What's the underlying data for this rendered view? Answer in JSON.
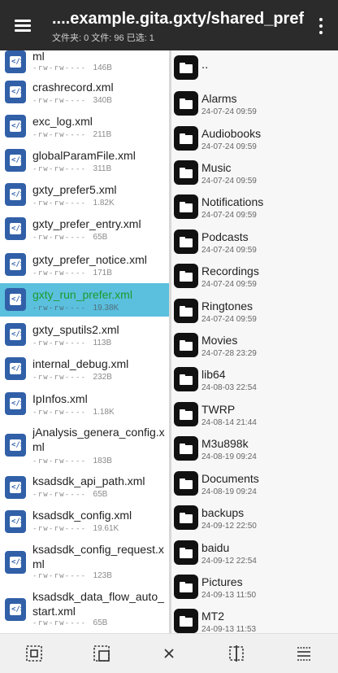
{
  "header": {
    "title": "....example.gita.gxty/shared_prefs/",
    "subtitle": "文件夹: 0  文件: 96  已选: 1"
  },
  "left_pane": {
    "files": [
      {
        "name": "ml",
        "perm": "-rw-rw----",
        "size": "146B",
        "selected": false
      },
      {
        "name": "crashrecord.xml",
        "perm": "-rw-rw----",
        "size": "340B",
        "selected": false
      },
      {
        "name": "exc_log.xml",
        "perm": "-rw-rw----",
        "size": "211B",
        "selected": false
      },
      {
        "name": "globalParamFile.xml",
        "perm": "-rw-rw----",
        "size": "311B",
        "selected": false
      },
      {
        "name": "gxty_prefer5.xml",
        "perm": "-rw-rw----",
        "size": "1.82K",
        "selected": false
      },
      {
        "name": "gxty_prefer_entry.xml",
        "perm": "-rw-rw----",
        "size": "65B",
        "selected": false
      },
      {
        "name": "gxty_prefer_notice.xml",
        "perm": "-rw-rw----",
        "size": "171B",
        "selected": false
      },
      {
        "name": "gxty_run_prefer.xml",
        "perm": "-rw-rw----",
        "size": "19.38K",
        "selected": true
      },
      {
        "name": "gxty_sputils2.xml",
        "perm": "-rw-rw----",
        "size": "113B",
        "selected": false
      },
      {
        "name": "internal_debug.xml",
        "perm": "-rw-rw----",
        "size": "232B",
        "selected": false
      },
      {
        "name": "IpInfos.xml",
        "perm": "-rw-rw----",
        "size": "1.18K",
        "selected": false
      },
      {
        "name": "jAnalysis_genera_config.xml",
        "perm": "-rw-rw----",
        "size": "183B",
        "selected": false
      },
      {
        "name": "ksadsdk_api_path.xml",
        "perm": "-rw-rw----",
        "size": "65B",
        "selected": false
      },
      {
        "name": "ksadsdk_config.xml",
        "perm": "-rw-rw----",
        "size": "19.61K",
        "selected": false
      },
      {
        "name": "ksadsdk_config_request.xml",
        "perm": "-rw-rw----",
        "size": "123B",
        "selected": false
      },
      {
        "name": "ksadsdk_data_flow_auto_start.xml",
        "perm": "-rw-rw----",
        "size": "65B",
        "selected": false
      }
    ]
  },
  "right_pane": {
    "folders": [
      {
        "name": "..",
        "date": ""
      },
      {
        "name": "Alarms",
        "date": "24-07-24 09:59"
      },
      {
        "name": "Audiobooks",
        "date": "24-07-24 09:59"
      },
      {
        "name": "Music",
        "date": "24-07-24 09:59"
      },
      {
        "name": "Notifications",
        "date": "24-07-24 09:59"
      },
      {
        "name": "Podcasts",
        "date": "24-07-24 09:59"
      },
      {
        "name": "Recordings",
        "date": "24-07-24 09:59"
      },
      {
        "name": "Ringtones",
        "date": "24-07-24 09:59"
      },
      {
        "name": "Movies",
        "date": "24-07-28 23:29"
      },
      {
        "name": "lib64",
        "date": "24-08-03 22:54"
      },
      {
        "name": "TWRP",
        "date": "24-08-14 21:44"
      },
      {
        "name": "M3u898k",
        "date": "24-08-19 09:24"
      },
      {
        "name": "Documents",
        "date": "24-08-19 09:24"
      },
      {
        "name": "backups",
        "date": "24-09-12 22:50"
      },
      {
        "name": "baidu",
        "date": "24-09-12 22:54"
      },
      {
        "name": "Pictures",
        "date": "24-09-13 11:50"
      },
      {
        "name": "MT2",
        "date": "24-09-13 11:53"
      }
    ]
  },
  "toolbar": {
    "icons": [
      "select-all-icon",
      "select-range-icon",
      "close-icon",
      "split-view-icon",
      "list-icon"
    ]
  },
  "colors": {
    "topbar": "#2b2b2b",
    "selection": "#5bbfde",
    "file_icon": "#3160a8",
    "selected_text": "#1a9d2e"
  }
}
